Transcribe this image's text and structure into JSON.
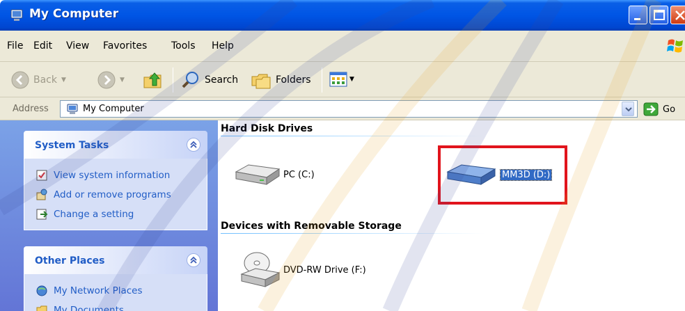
{
  "window": {
    "title": "My Computer",
    "controls": [
      "minimize",
      "maximize",
      "close"
    ]
  },
  "menubar": {
    "items": [
      "File",
      "Edit",
      "View",
      "Favorites",
      "Tools",
      "Help"
    ]
  },
  "toolbar": {
    "back_label": "Back",
    "search_label": "Search",
    "folders_label": "Folders"
  },
  "address": {
    "label": "Address",
    "value": "My Computer",
    "go_label": "Go"
  },
  "taskpane": {
    "system_tasks": {
      "title": "System Tasks",
      "links": [
        "View system information",
        "Add or remove programs",
        "Change a setting"
      ]
    },
    "other_places": {
      "title": "Other Places",
      "links": [
        "My Network Places",
        "My Documents"
      ]
    }
  },
  "content": {
    "groups": [
      {
        "title": "Hard Disk Drives",
        "drives": [
          "PC (C:)",
          "MM3D (D:)"
        ]
      },
      {
        "title": "Devices with Removable Storage",
        "drives": [
          "DVD-RW Drive (F:)"
        ]
      }
    ]
  },
  "colors": {
    "title_bar": "#0055e5",
    "task_pane": "#6d8fe0",
    "link": "#215dc6",
    "selection": "#316ac5",
    "highlight_box": "#e1141c"
  }
}
